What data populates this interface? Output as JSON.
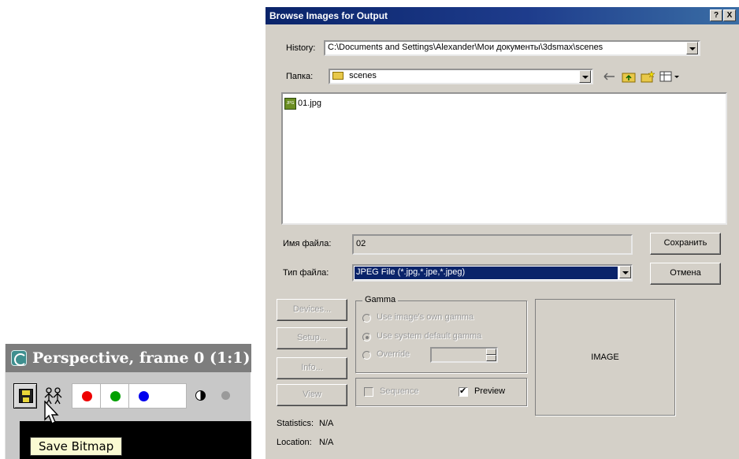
{
  "viewport": {
    "title": "Perspective, frame 0 (1:1)",
    "tooltip": "Save Bitmap",
    "toolbar": {
      "icons": [
        "save-bitmap-icon",
        "clone-window-icon",
        "red-channel-icon",
        "green-channel-icon",
        "blue-channel-icon",
        "mono-icon",
        "alpha-channel-icon"
      ],
      "channel_colors": [
        "#ee0000",
        "#00a000",
        "#0000ee"
      ]
    }
  },
  "dialog": {
    "title": "Browse Images for Output",
    "help_button": "?",
    "close_button": "X",
    "history_label": "History:",
    "history_value": "C:\\Documents and Settings\\Alexander\\Мои документы\\3dsmax\\scenes",
    "folder_label": "Папка:",
    "folder_value": "scenes",
    "files": [
      "01.jpg"
    ],
    "filename_label": "Имя файла:",
    "filename_value": "02",
    "filetype_label": "Тип файла:",
    "filetype_value": "JPEG File (*.jpg,*.jpe,*.jpeg)",
    "save_button": "Сохранить",
    "cancel_button": "Отмена",
    "side_buttons": [
      "Devices...",
      "Setup...",
      "Info...",
      "View"
    ],
    "gamma": {
      "title": "Gamma",
      "options": [
        "Use image's own gamma",
        "Use system default gamma",
        "Override"
      ]
    },
    "sequence_label": "Sequence",
    "preview_label": "Preview",
    "image_label": "IMAGE",
    "statistics_label": "Statistics:",
    "statistics_value": "N/A",
    "location_label": "Location:",
    "location_value": "N/A"
  }
}
